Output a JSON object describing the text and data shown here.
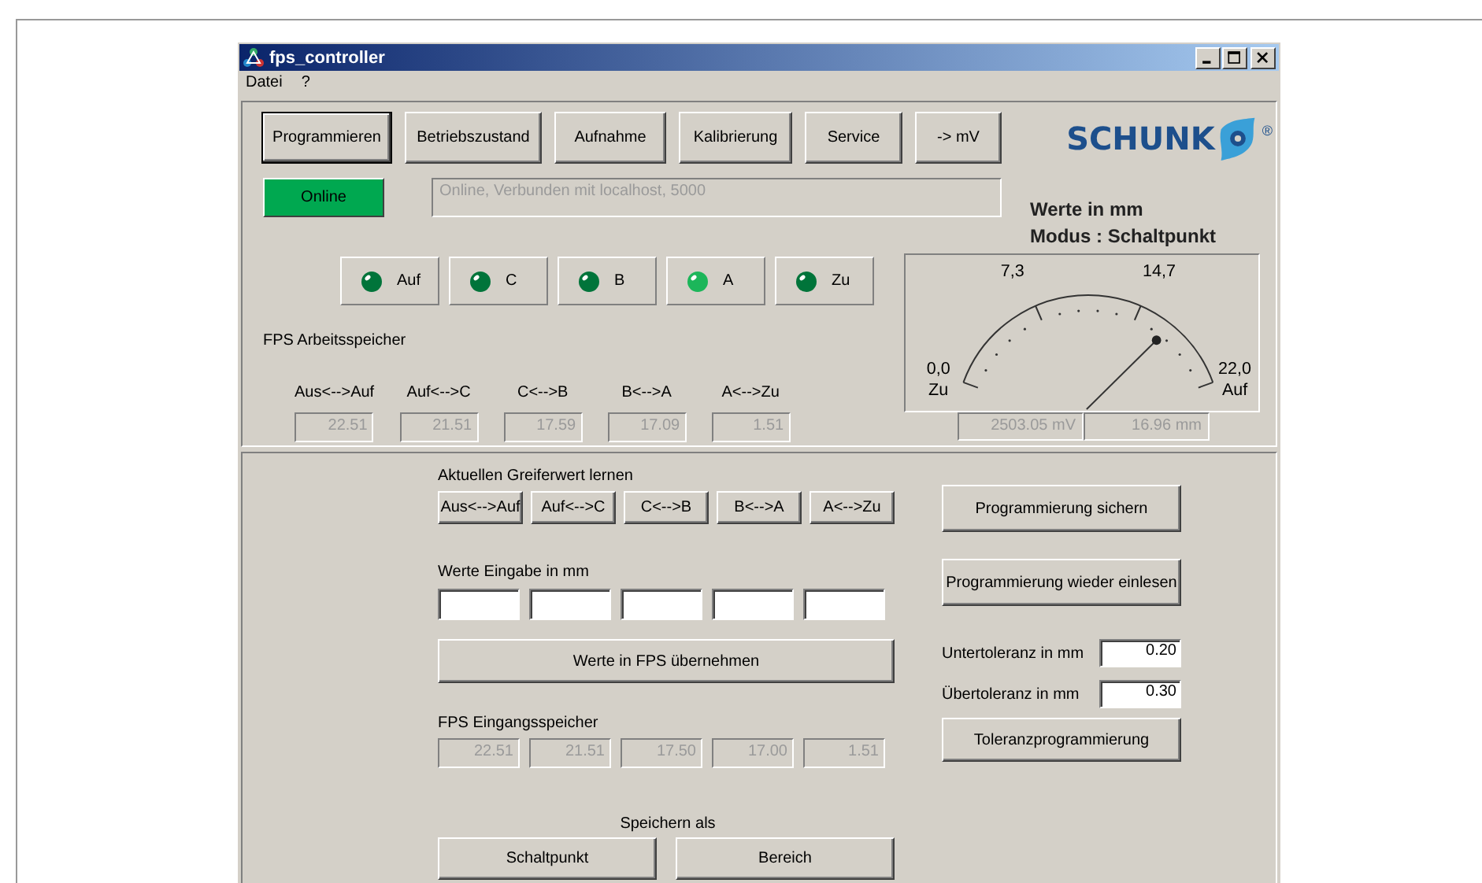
{
  "window": {
    "title": "fps_controller"
  },
  "menu": [
    "Datei",
    "?"
  ],
  "tabs": [
    {
      "label": "Programmieren",
      "selected": true
    },
    {
      "label": "Betriebszustand",
      "selected": false
    },
    {
      "label": "Aufnahme",
      "selected": false
    },
    {
      "label": "Kalibrierung",
      "selected": false
    },
    {
      "label": "Service",
      "selected": false
    },
    {
      "label": "-> mV",
      "selected": false
    }
  ],
  "logo": {
    "text": "SCHUNK",
    "mark": "®"
  },
  "connection": {
    "label": "Online",
    "on": true,
    "message": "Online, Verbunden mit localhost, 5000"
  },
  "info": [
    "Werte in mm",
    "Modus : Schaltpunkt"
  ],
  "leds": [
    {
      "label": "Auf",
      "on": false
    },
    {
      "label": "C",
      "on": false
    },
    {
      "label": "B",
      "on": false
    },
    {
      "label": "A",
      "on": true
    },
    {
      "label": "Zu",
      "on": false
    }
  ],
  "working_memory": {
    "title": "FPS Arbeitsspeicher",
    "disabled": true,
    "columns": [
      {
        "label": "Aus<-->Auf",
        "value": "22.51"
      },
      {
        "label": "Auf<-->C",
        "value": "21.51"
      },
      {
        "label": "C<-->B",
        "value": "17.59"
      },
      {
        "label": "B<-->A",
        "value": "17.09"
      },
      {
        "label": "A<-->Zu",
        "value": "1.51"
      }
    ]
  },
  "gauge": {
    "ticks": [
      "0,0",
      "7,3",
      "14,7",
      "22,0"
    ],
    "end_labels": [
      "Zu",
      "Auf"
    ],
    "readouts": [
      "2503.05 mV",
      "16.96 mm"
    ]
  },
  "learn": {
    "title": "Aktuellen Greiferwert lernen",
    "buttons": [
      "Aus<-->Auf",
      "Auf<-->C",
      "C<-->B",
      "B<-->A",
      "A<-->Zu"
    ]
  },
  "input": {
    "title": "Werte Eingabe in mm",
    "apply_button": "Werte in FPS übernehmen"
  },
  "input_memory": {
    "title": "FPS Eingangsspeicher",
    "disabled": true,
    "values": [
      "22.51",
      "21.51",
      "17.50",
      "17.00",
      "1.51"
    ]
  },
  "save_as": {
    "title": "Speichern als",
    "buttons": [
      "Schaltpunkt",
      "Bereich"
    ]
  },
  "program_buttons": [
    "Programmierung sichern",
    "Programmierung wieder einlesen"
  ],
  "tolerances": [
    {
      "label": "Untertoleranz in mm",
      "value": "0.20"
    },
    {
      "label": "Übertoleranz in mm",
      "value": "0.30"
    }
  ],
  "tolerance_button": "Toleranzprogrammierung"
}
